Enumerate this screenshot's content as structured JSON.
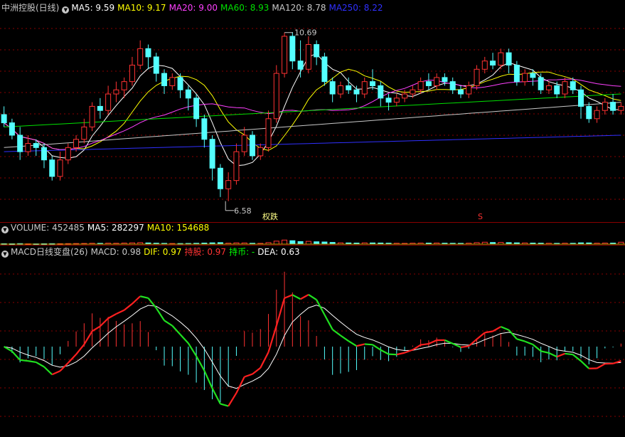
{
  "colors": {
    "up": "#ff3232",
    "down": "#54ffff",
    "ma5": "#ffffff",
    "ma10": "#ffff00",
    "ma20": "#ff40ff",
    "ma60": "#00e000",
    "ma120": "#c8c8c8",
    "ma250": "#3030ff",
    "grid": "#8a0000",
    "text": "#c8c8c8"
  },
  "price_panel": {
    "title": "中洲控股(日线)",
    "legend": [
      {
        "label": "MA5: 9.59",
        "color": "#ffffff"
      },
      {
        "label": "MA10: 9.17",
        "color": "#ffff00"
      },
      {
        "label": "MA20: 9.00",
        "color": "#ff40ff"
      },
      {
        "label": "MA60: 8.93",
        "color": "#00e000"
      },
      {
        "label": "MA120: 8.78",
        "color": "#c8c8c8"
      },
      {
        "label": "MA250: 8.22",
        "color": "#3030ff"
      }
    ],
    "high_label": "10.69",
    "low_label": "6.58",
    "marker_left": "权跌",
    "marker_right": "S"
  },
  "volume_panel": {
    "title": "VOLUME: 452485",
    "ma5": "MA5: 282297",
    "ma10": "MA10: 154688"
  },
  "macd_panel": {
    "title": "MACD日线变盘(26)",
    "macd": "MACD: 0.98",
    "dif": "DIF: 0.97",
    "hold": "持股: 0.97",
    "cash": "持币: -",
    "dea": "DEA: 0.63"
  },
  "chart_data": {
    "type": "candlestick",
    "title": "中洲控股(日线)",
    "ylim": [
      6.3,
      11.1
    ],
    "xlabel": "",
    "ylabel": "",
    "candles": [
      [
        8.7,
        8.5,
        8.9,
        8.4
      ],
      [
        8.5,
        8.2,
        8.6,
        8.1
      ],
      [
        8.2,
        7.8,
        8.4,
        7.6
      ],
      [
        7.8,
        8.0,
        8.2,
        7.7
      ],
      [
        8.0,
        7.9,
        8.1,
        7.7
      ],
      [
        7.9,
        7.6,
        8.0,
        7.4
      ],
      [
        7.6,
        7.2,
        7.7,
        7.1
      ],
      [
        7.2,
        7.6,
        7.8,
        7.1
      ],
      [
        7.6,
        7.9,
        8.0,
        7.5
      ],
      [
        7.9,
        8.1,
        8.2,
        7.8
      ],
      [
        8.1,
        8.4,
        8.6,
        8.0
      ],
      [
        8.4,
        8.9,
        9.0,
        8.3
      ],
      [
        8.9,
        8.8,
        9.1,
        8.6
      ],
      [
        8.8,
        9.2,
        9.4,
        8.7
      ],
      [
        9.2,
        9.3,
        9.5,
        9.0
      ],
      [
        9.3,
        9.5,
        9.6,
        9.1
      ],
      [
        9.5,
        9.9,
        10.1,
        9.4
      ],
      [
        9.9,
        10.3,
        10.5,
        9.8
      ],
      [
        10.3,
        10.1,
        10.4,
        9.8
      ],
      [
        10.1,
        9.7,
        10.2,
        9.5
      ],
      [
        9.7,
        9.4,
        9.8,
        9.2
      ],
      [
        9.4,
        9.6,
        9.7,
        9.3
      ],
      [
        9.6,
        9.3,
        9.7,
        9.1
      ],
      [
        9.3,
        9.1,
        9.4,
        8.8
      ],
      [
        9.1,
        8.6,
        9.2,
        8.4
      ],
      [
        8.6,
        8.1,
        8.7,
        7.9
      ],
      [
        8.1,
        7.4,
        8.2,
        7.1
      ],
      [
        7.4,
        6.9,
        7.5,
        6.7
      ],
      [
        6.9,
        7.1,
        7.3,
        6.6
      ],
      [
        7.1,
        7.8,
        8.0,
        7.0
      ],
      [
        7.8,
        8.2,
        8.4,
        7.7
      ],
      [
        8.2,
        7.7,
        8.3,
        7.6
      ],
      [
        7.7,
        7.9,
        8.0,
        7.6
      ],
      [
        7.9,
        8.6,
        8.8,
        7.8
      ],
      [
        8.6,
        9.7,
        9.9,
        8.5
      ],
      [
        9.7,
        10.6,
        10.69,
        9.6
      ],
      [
        10.6,
        10.0,
        10.7,
        9.8
      ],
      [
        10.0,
        9.8,
        10.5,
        9.6
      ],
      [
        9.8,
        10.4,
        10.6,
        9.7
      ],
      [
        10.4,
        10.1,
        10.5,
        9.9
      ],
      [
        10.1,
        9.5,
        10.2,
        9.4
      ],
      [
        9.5,
        9.2,
        9.6,
        9.0
      ],
      [
        9.2,
        9.4,
        9.5,
        9.1
      ],
      [
        9.4,
        9.3,
        9.6,
        9.2
      ],
      [
        9.3,
        9.2,
        9.4,
        9.0
      ],
      [
        9.2,
        9.5,
        9.6,
        9.1
      ],
      [
        9.5,
        9.4,
        9.8,
        9.3
      ],
      [
        9.4,
        9.1,
        9.5,
        8.9
      ],
      [
        9.1,
        9.0,
        9.2,
        8.8
      ],
      [
        9.0,
        9.1,
        9.2,
        8.9
      ],
      [
        9.1,
        9.2,
        9.3,
        9.0
      ],
      [
        9.2,
        9.3,
        9.4,
        9.1
      ],
      [
        9.3,
        9.5,
        9.6,
        9.2
      ],
      [
        9.5,
        9.4,
        9.7,
        9.3
      ],
      [
        9.4,
        9.6,
        9.7,
        9.3
      ],
      [
        9.6,
        9.5,
        9.7,
        9.4
      ],
      [
        9.5,
        9.3,
        9.6,
        9.2
      ],
      [
        9.3,
        9.2,
        9.4,
        9.1
      ],
      [
        9.2,
        9.4,
        9.5,
        9.1
      ],
      [
        9.4,
        9.8,
        9.9,
        9.3
      ],
      [
        9.8,
        10.0,
        10.1,
        9.7
      ],
      [
        10.0,
        9.9,
        10.2,
        9.8
      ],
      [
        9.9,
        10.2,
        10.3,
        9.8
      ],
      [
        10.2,
        9.9,
        10.3,
        9.7
      ],
      [
        9.9,
        9.5,
        10.0,
        9.4
      ],
      [
        9.5,
        9.7,
        9.8,
        9.4
      ],
      [
        9.7,
        9.6,
        9.8,
        9.4
      ],
      [
        9.6,
        9.3,
        9.7,
        9.2
      ],
      [
        9.3,
        9.4,
        9.5,
        9.2
      ],
      [
        9.4,
        9.2,
        9.5,
        9.1
      ],
      [
        9.2,
        9.5,
        9.6,
        9.1
      ],
      [
        9.5,
        9.3,
        9.6,
        9.2
      ],
      [
        9.3,
        8.9,
        9.4,
        8.6
      ],
      [
        8.9,
        8.6,
        9.0,
        8.5
      ],
      [
        8.6,
        8.8,
        8.9,
        8.5
      ],
      [
        8.8,
        9.0,
        9.1,
        8.7
      ],
      [
        9.0,
        8.8,
        9.2,
        8.7
      ],
      [
        8.8,
        8.9,
        9.0,
        8.7
      ]
    ],
    "volume": [
      0.1,
      0.08,
      0.12,
      0.07,
      0.06,
      0.09,
      0.11,
      0.1,
      0.12,
      0.14,
      0.16,
      0.2,
      0.18,
      0.22,
      0.2,
      0.25,
      0.3,
      0.35,
      0.28,
      0.22,
      0.18,
      0.15,
      0.14,
      0.16,
      0.2,
      0.25,
      0.3,
      0.35,
      0.22,
      0.3,
      0.28,
      0.2,
      0.18,
      0.35,
      0.7,
      0.95,
      0.8,
      0.6,
      0.65,
      0.55,
      0.5,
      0.4,
      0.3,
      0.28,
      0.25,
      0.3,
      0.28,
      0.26,
      0.22,
      0.2,
      0.18,
      0.22,
      0.25,
      0.24,
      0.26,
      0.22,
      0.2,
      0.18,
      0.22,
      0.35,
      0.45,
      0.38,
      0.4,
      0.35,
      0.3,
      0.28,
      0.25,
      0.22,
      0.2,
      0.18,
      0.22,
      0.2,
      0.3,
      0.28,
      0.22,
      0.25,
      0.24,
      0.45
    ],
    "macd_range": [
      -2.0,
      2.0
    ]
  }
}
